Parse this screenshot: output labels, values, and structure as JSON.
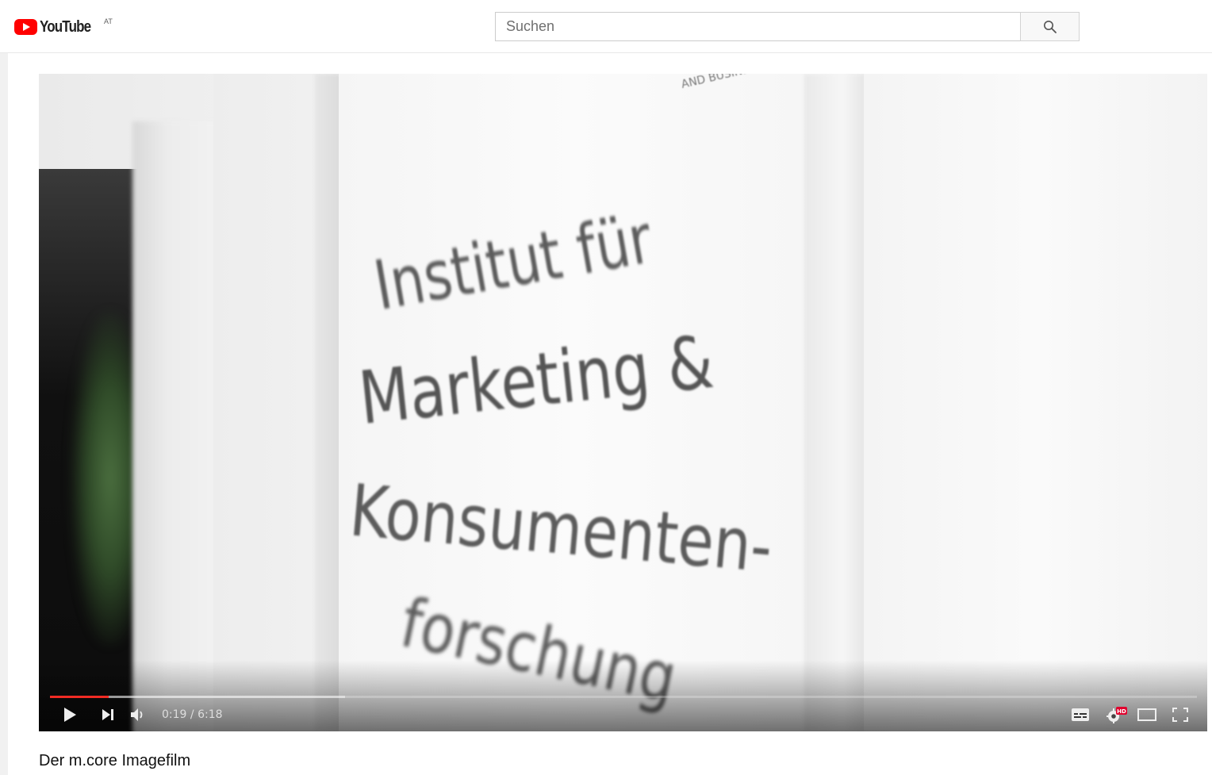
{
  "header": {
    "logo_text": "YouTube",
    "country_code": "AT",
    "search": {
      "placeholder": "Suchen",
      "value": ""
    },
    "search_button_icon": "search-icon"
  },
  "player": {
    "frame_text": {
      "top": "AND BUSINE",
      "line1": "Institut für",
      "line2": "Marketing &",
      "line3": "Konsumenten-",
      "line4": "forschung"
    },
    "progress": {
      "played_fraction": 0.051,
      "buffered_fraction": 0.257
    },
    "time_current": "0:19",
    "time_separator": "/",
    "time_duration": "6:18",
    "controls": [
      "play-icon",
      "next-icon",
      "volume-icon",
      "subtitles-icon",
      "settings-hd-icon",
      "theater-mode-icon",
      "fullscreen-icon"
    ],
    "hd_badge": "HD",
    "accent_color": "#f12b24"
  },
  "video": {
    "title": "Der m.core Imagefilm"
  }
}
